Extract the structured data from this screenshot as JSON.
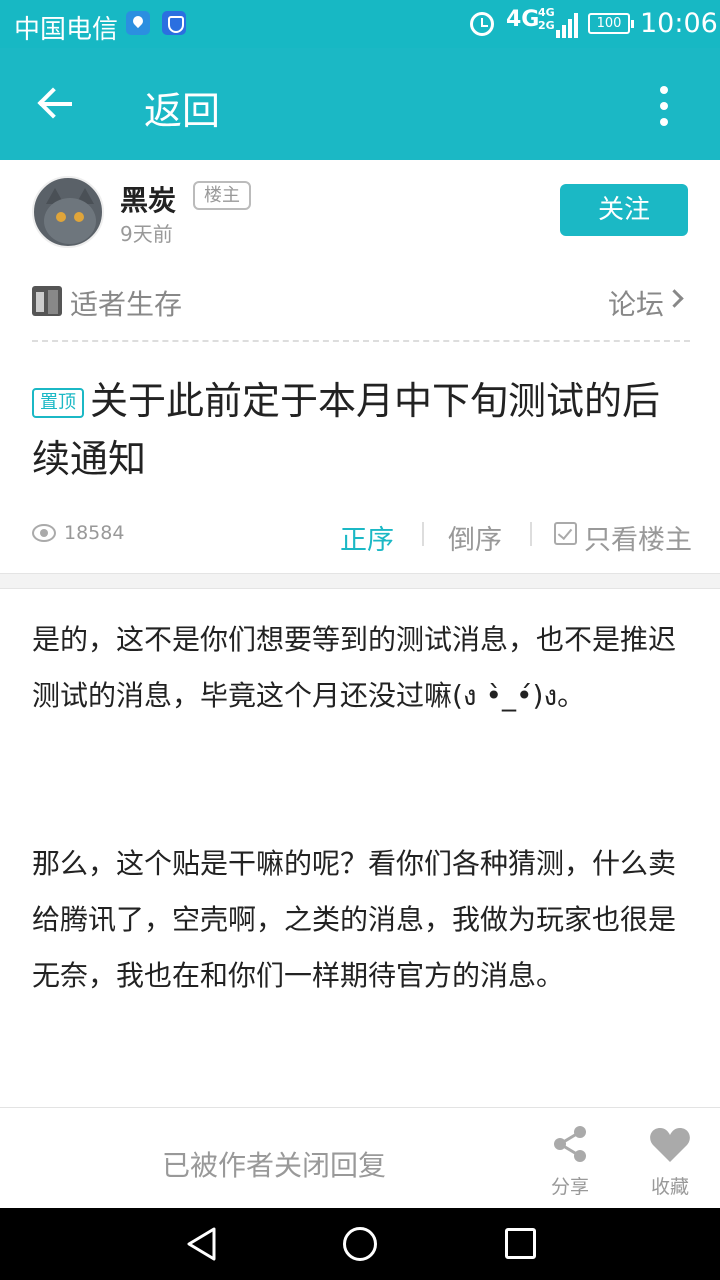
{
  "status_bar": {
    "carrier": "中国电信",
    "network": "4G",
    "network_small": [
      "4G",
      "2G"
    ],
    "battery": "100",
    "time": "10:06"
  },
  "header": {
    "back_label": "返回",
    "icons": [
      "back-arrow-icon",
      "more-vertical-icon"
    ]
  },
  "author": {
    "name": "黑炭",
    "badge": "楼主",
    "time": "9天前",
    "follow_label": "关注"
  },
  "forum": {
    "name": "适者生存",
    "link": "论坛"
  },
  "post": {
    "pin_label": "置顶",
    "title": "关于此前定于本月中下旬测试的后续通知",
    "views": "18584",
    "sort_asc": "正序",
    "sort_desc": "倒序",
    "only_owner": "只看楼主",
    "paragraphs": [
      "是的，这不是你们想要等到的测试消息，也不是推迟测试的消息，毕竟这个月还没过嘛(ง •̀_•́)ง。",
      "那么，这个贴是干嘛的呢？看你们各种猜测，什么卖给腾讯了，空壳啊，之类的消息，我做为玩家也很是无奈，我也在和你们一样期待官方的消息。"
    ]
  },
  "bottom_bar": {
    "closed_notice": "已被作者关闭回复",
    "share_label": "分享",
    "favorite_label": "收藏"
  },
  "colors": {
    "accent": "#1bb8c5",
    "muted_text": "#999999"
  }
}
